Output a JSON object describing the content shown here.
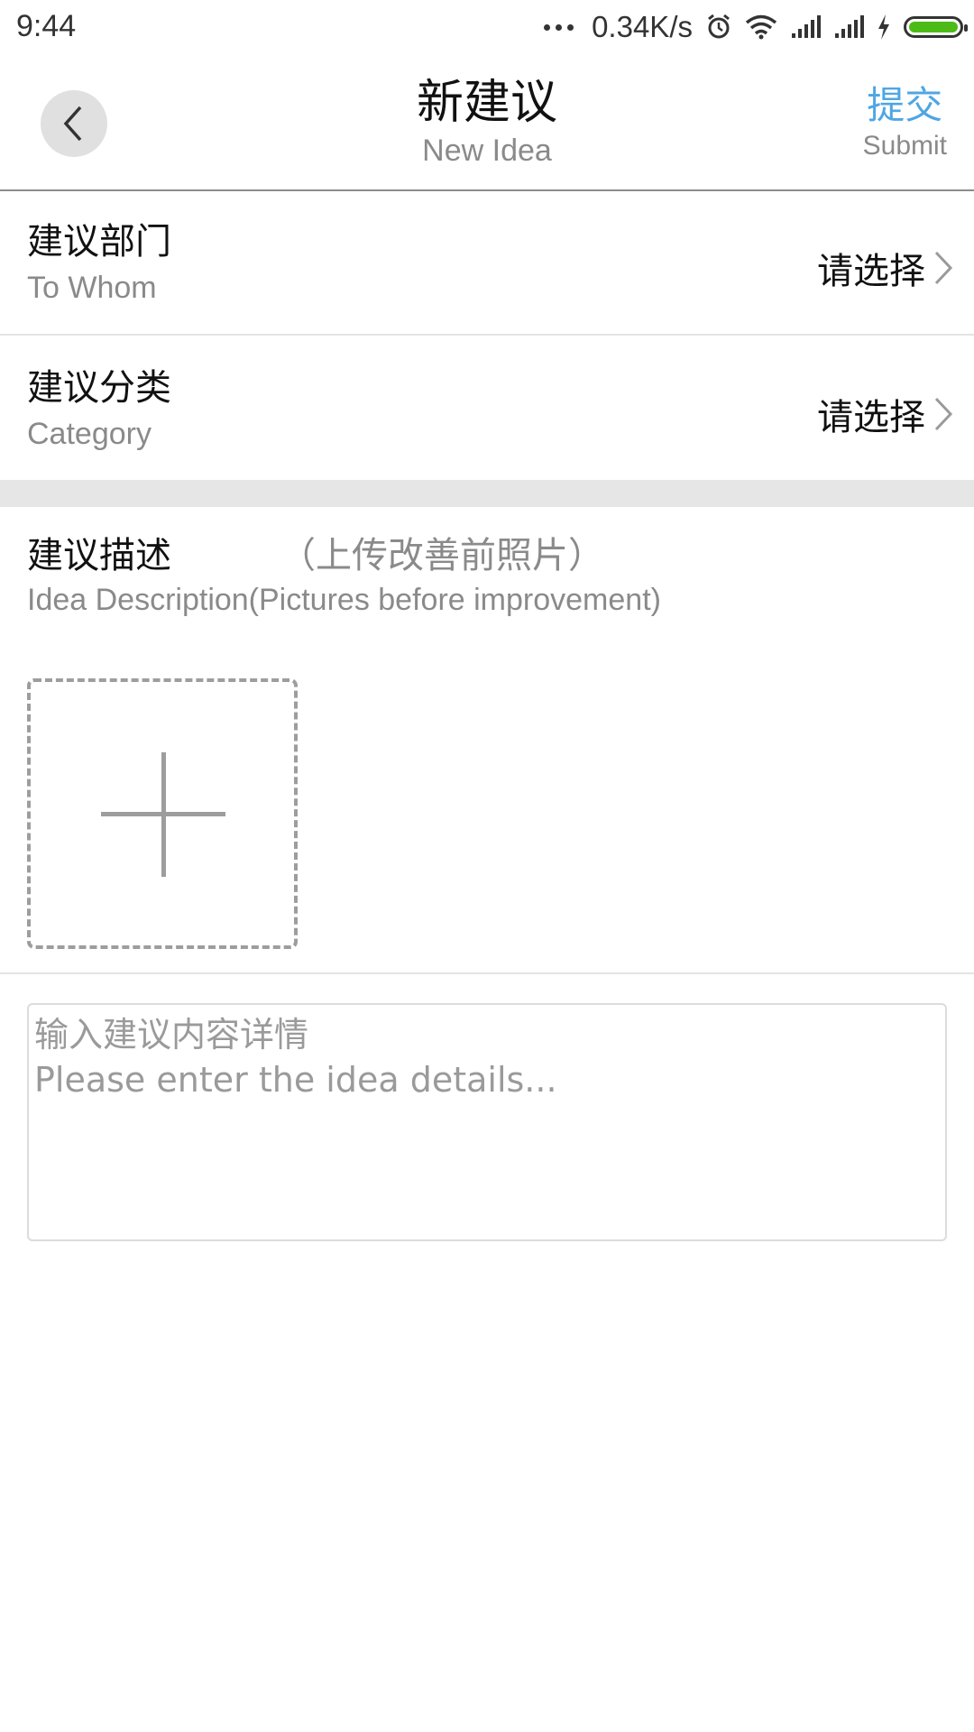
{
  "status_bar": {
    "time": "9:44",
    "net_speed": "0.34K/s",
    "icons": [
      "more-dots-icon",
      "alarm-icon",
      "wifi-icon",
      "signal-icon",
      "signal-icon",
      "charging-icon",
      "battery-icon"
    ],
    "battery_color": "#4cbb17"
  },
  "header": {
    "back_icon": "chevron-left-icon",
    "title_cn": "新建议",
    "title_en": "New Idea",
    "submit_cn": "提交",
    "submit_en": "Submit",
    "accent_color": "#4ea6e3"
  },
  "form": {
    "department": {
      "label_cn": "建议部门",
      "label_en": "To Whom",
      "value": "请选择"
    },
    "category": {
      "label_cn": "建议分类",
      "label_en": "Category",
      "value": "请选择"
    },
    "description": {
      "label_cn": "建议描述",
      "hint_cn": "（上传改善前照片）",
      "label_en": "Idea Description(Pictures before improvement)",
      "add_icon": "plus-icon"
    },
    "details": {
      "value": "",
      "placeholder": "输入建议内容详情\nPlease enter the idea details..."
    }
  }
}
